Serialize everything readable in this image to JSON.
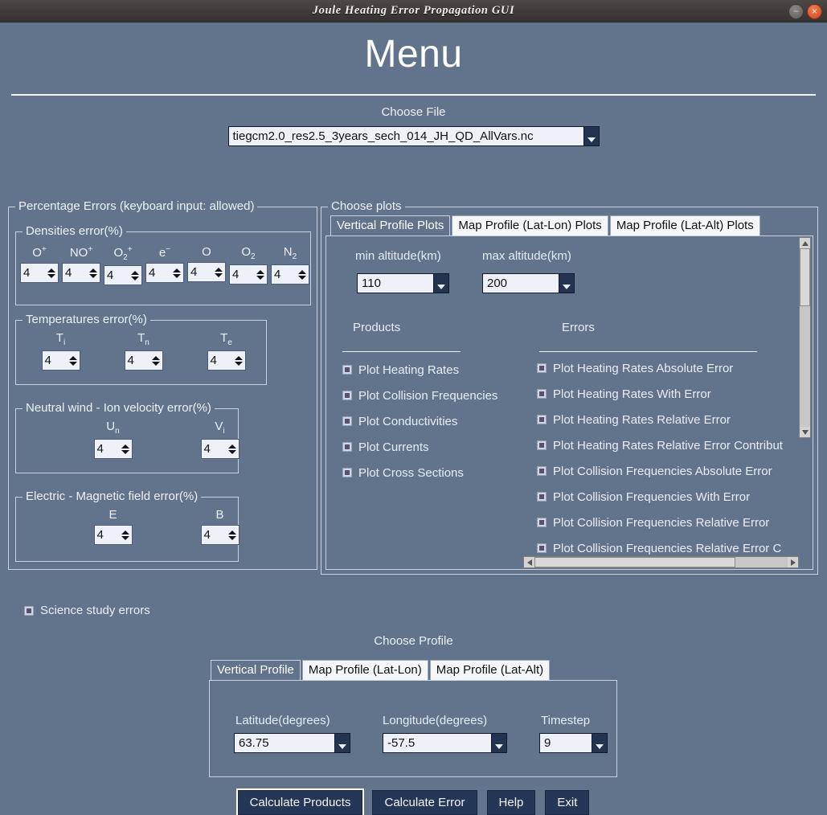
{
  "window": {
    "title": "Joule Heating Error Propagation GUI",
    "minimize_icon": "minimize-icon",
    "close_icon": "close-icon",
    "minimize_glyph": "−",
    "close_glyph": "×"
  },
  "page_title": "Menu",
  "choose_file": {
    "label": "Choose File",
    "value": "tiegcm2.0_res2.5_3years_sech_014_JH_QD_AllVars.nc"
  },
  "percentage_errors": {
    "legend": "Percentage Errors (keyboard input: allowed)",
    "densities": {
      "legend": "Densities error(%)",
      "fields": [
        {
          "base": "O",
          "sup": "+",
          "sub": "",
          "value": "4"
        },
        {
          "base": "NO",
          "sup": "+",
          "sub": "",
          "value": "4"
        },
        {
          "base": "O",
          "sup": "+",
          "sub": "2",
          "value": "4"
        },
        {
          "base": "e",
          "sup": "−",
          "sub": "",
          "value": "4"
        },
        {
          "base": "O",
          "sup": "",
          "sub": "",
          "value": "4"
        },
        {
          "base": "O",
          "sup": "",
          "sub": "2",
          "value": "4"
        },
        {
          "base": "N",
          "sup": "",
          "sub": "2",
          "value": "4"
        }
      ]
    },
    "temperatures": {
      "legend": "Temperatures error(%)",
      "fields": [
        {
          "base": "T",
          "sup": "",
          "sub": "i",
          "value": "4"
        },
        {
          "base": "T",
          "sup": "",
          "sub": "n",
          "value": "4"
        },
        {
          "base": "T",
          "sup": "",
          "sub": "e",
          "value": "4"
        }
      ]
    },
    "wind": {
      "legend": "Neutral wind - Ion velocity error(%)",
      "fields": [
        {
          "base": "U",
          "sup": "",
          "sub": "n",
          "value": "4"
        },
        {
          "base": "V",
          "sup": "",
          "sub": "i",
          "value": "4"
        }
      ]
    },
    "field": {
      "legend": "Electric - Magnetic field error(%)",
      "fields": [
        {
          "base": "E",
          "sup": "",
          "sub": "",
          "value": "4"
        },
        {
          "base": "B",
          "sup": "",
          "sub": "",
          "value": "4"
        }
      ]
    }
  },
  "choose_plots": {
    "legend": "Choose plots",
    "tabs": [
      {
        "label": "Vertical Profile Plots",
        "active": true
      },
      {
        "label": "Map Profile (Lat-Lon) Plots",
        "active": false
      },
      {
        "label": "Map Profile (Lat-Alt) Plots",
        "active": false
      }
    ],
    "min_alt_label": "min altitude(km)",
    "min_alt_value": "110",
    "max_alt_label": "max altitude(km)",
    "max_alt_value": "200",
    "products_header": "Products",
    "errors_header": "Errors",
    "products": [
      "Plot Heating Rates",
      "Plot Collision Frequencies",
      "Plot Conductivities",
      "Plot Currents",
      "Plot Cross Sections"
    ],
    "errors": [
      "Plot Heating Rates Absolute Error",
      "Plot Heating Rates With Error",
      "Plot Heating Rates Relative Error",
      "Plot Heating Rates Relative Error Contribut",
      "Plot Collision Frequencies Absolute Error",
      "Plot Collision Frequencies With Error",
      "Plot Collision Frequencies Relative Error",
      "Plot Collision Frequencies Relative Error C"
    ]
  },
  "science_study_errors": "Science study errors",
  "choose_profile": {
    "label": "Choose Profile",
    "tabs": [
      {
        "label": "Vertical Profile",
        "active": true
      },
      {
        "label": "Map Profile (Lat-Lon)",
        "active": false
      },
      {
        "label": "Map Profile (Lat-Alt)",
        "active": false
      }
    ],
    "latitude_label": "Latitude(degrees)",
    "latitude_value": "63.75",
    "longitude_label": "Longitude(degrees)",
    "longitude_value": "-57.5",
    "timestep_label": "Timestep",
    "timestep_value": "9"
  },
  "buttons": {
    "calculate_products": "Calculate Products",
    "calculate_error": "Calculate Error",
    "help": "Help",
    "exit": "Exit"
  },
  "colors": {
    "background": "#62738c",
    "titlebar": "#3e3b39",
    "button": "#253757",
    "field": "#eef1f8",
    "close": "#d0451b"
  }
}
